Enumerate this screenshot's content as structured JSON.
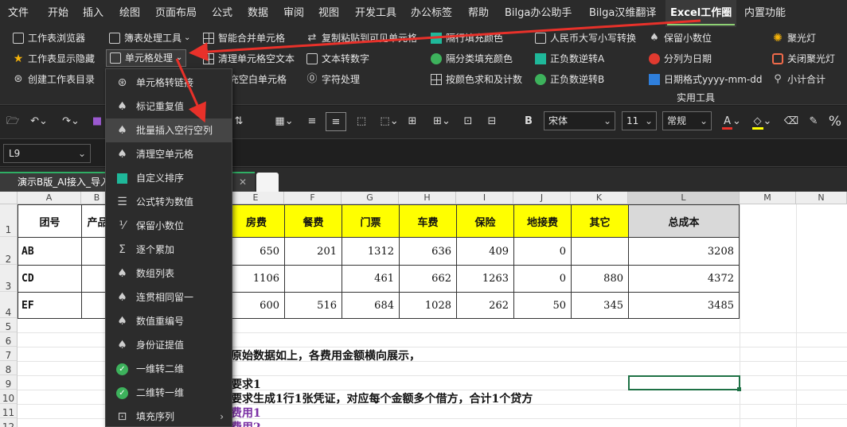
{
  "menubar": {
    "items": [
      "文件",
      "开始",
      "插入",
      "绘图",
      "页面布局",
      "公式",
      "数据",
      "审阅",
      "视图",
      "开发工具",
      "办公标签",
      "帮助",
      "Bilga办公助手",
      "Bilga汉维翻译",
      "Excel工作圈",
      "内置功能"
    ],
    "active": "Excel工作圈"
  },
  "ribbon": {
    "col1": [
      "工作表浏览器",
      "工作表显示隐藏",
      "创建工作表目录"
    ],
    "col2": [
      "簿表处理工具",
      "单元格处理"
    ],
    "col3": [
      "智能合并单元格",
      "清理单元格空文本",
      "充空白单元格"
    ],
    "col4": [
      "复制粘贴到可见单元格",
      "文本转数字",
      "字符处理"
    ],
    "col5": [
      "隔行填充颜色",
      "隔分类填充颜色",
      "按颜色求和及计数"
    ],
    "col6": [
      "人民币大写小写转换",
      "正负数逆转A",
      "正负数逆转B"
    ],
    "col7": [
      "保留小数位",
      "分列为日期",
      "日期格式yyyy-mm-dd"
    ],
    "col8": [
      "聚光灯",
      "关闭聚光灯",
      "小计合计"
    ],
    "group_label": "实用工具"
  },
  "toolbar": {
    "font": "宋体",
    "size": "11",
    "format": "常规",
    "bold": "B",
    "percent": "%"
  },
  "formulabar": {
    "namebox": "L9"
  },
  "tabs": {
    "active": "演示B版_AI接入_导入"
  },
  "sheet": {
    "columns": [
      "A",
      "B",
      "C",
      "D",
      "E",
      "F",
      "G",
      "H",
      "I",
      "J",
      "K",
      "L",
      "M",
      "N"
    ],
    "rows": [
      "1",
      "2",
      "3",
      "4",
      "5",
      "6",
      "7",
      "8",
      "9",
      "10",
      "11",
      "12"
    ],
    "headers": {
      "a": "团号",
      "b": "产品",
      "e": "房费",
      "f": "餐费",
      "g": "门票",
      "h": "车费",
      "i": "保险",
      "j": "地接费",
      "k": "其它",
      "l": "总成本"
    },
    "data": [
      {
        "a": "AB",
        "e": "650",
        "f": "201",
        "g": "1312",
        "h": "636",
        "i": "409",
        "j": "0",
        "k": "",
        "l": "3208"
      },
      {
        "a": "CD",
        "e": "1106",
        "f": "",
        "g": "461",
        "h": "662",
        "i": "1263",
        "j": "0",
        "k": "880",
        "l": "4372"
      },
      {
        "a": "EF",
        "e": "600",
        "f": "516",
        "g": "684",
        "h": "1028",
        "i": "262",
        "j": "50",
        "k": "345",
        "l": "3485"
      }
    ],
    "notes": {
      "line7": "原始数据如上，各费用金额横向展示，",
      "line9": "要求1",
      "line10": "要求生成1行1张凭证，对应每个金额多个借方，合计1个贷方",
      "line11": "费用1",
      "line12": "费用2"
    }
  },
  "dropdown": {
    "items": [
      "单元格转链接",
      "标记重复值",
      "批量插入空行空列",
      "清理空单元格",
      "自定义排序",
      "公式转为数值",
      "保留小数位",
      "逐个累加",
      "数组列表",
      "连贯相同留一",
      "数值重编号",
      "身份证提值",
      "一维转二维",
      "二维转一维",
      "填充序列"
    ],
    "hover_item": "批量插入空行空列"
  },
  "colors": {
    "accent": "#8ed174",
    "arrow": "#e8312a",
    "header_yellow": "#ffff00"
  }
}
